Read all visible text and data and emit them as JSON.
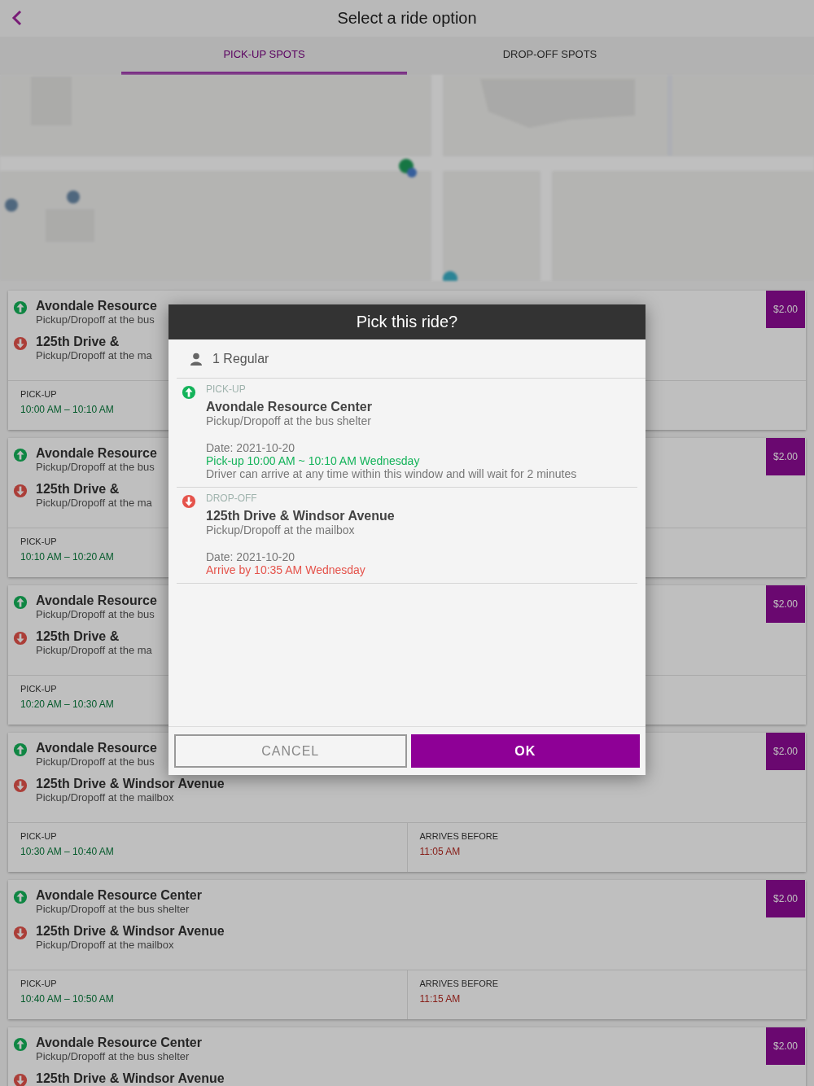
{
  "header": {
    "title": "Select a ride option"
  },
  "tabs": [
    {
      "label": "PICK-UP SPOTS",
      "selected": true
    },
    {
      "label": "DROP-OFF SPOTS",
      "selected": false
    }
  ],
  "rides": [
    {
      "pickup_name": "Avondale Resource",
      "pickup_note": "Pickup/Dropoff at the bus",
      "dropoff_name": "125th Drive &",
      "dropoff_note": "Pickup/Dropoff at the ma",
      "pickup_label": "PICK-UP",
      "pickup_window": "10:00 AM – 10:10 AM",
      "price": "$2.00"
    },
    {
      "pickup_name": "Avondale Resource",
      "pickup_note": "Pickup/Dropoff at the bus",
      "dropoff_name": "125th Drive &",
      "dropoff_note": "Pickup/Dropoff at the ma",
      "pickup_label": "PICK-UP",
      "pickup_window": "10:10 AM – 10:20 AM",
      "price": "$2.00"
    },
    {
      "pickup_name": "Avondale Resource",
      "pickup_note": "Pickup/Dropoff at the bus",
      "dropoff_name": "125th Drive &",
      "dropoff_note": "Pickup/Dropoff at the ma",
      "pickup_label": "PICK-UP",
      "pickup_window": "10:20 AM – 10:30 AM",
      "price": "$2.00"
    },
    {
      "pickup_name": "Avondale Resource",
      "pickup_note": "Pickup/Dropoff at the bus",
      "dropoff_name": "125th Drive & Windsor Avenue",
      "dropoff_note": "Pickup/Dropoff at the mailbox",
      "pickup_label": "PICK-UP",
      "pickup_window": "10:30 AM – 10:40 AM",
      "arrives_label": "ARRIVES BEFORE",
      "arrives_time": "11:05 AM",
      "price": "$2.00"
    },
    {
      "pickup_name": "Avondale Resource Center",
      "pickup_note": "Pickup/Dropoff at the bus shelter",
      "dropoff_name": "125th Drive & Windsor Avenue",
      "dropoff_note": "Pickup/Dropoff at the mailbox",
      "pickup_label": "PICK-UP",
      "pickup_window": "10:40 AM – 10:50 AM",
      "arrives_label": "ARRIVES BEFORE",
      "arrives_time": "11:15 AM",
      "price": "$2.00"
    },
    {
      "pickup_name": "Avondale Resource Center",
      "pickup_note": "Pickup/Dropoff at the bus shelter",
      "dropoff_name": "125th Drive & Windsor Avenue",
      "price": "$2.00"
    }
  ],
  "dialog": {
    "title": "Pick this ride?",
    "passengers": "1 Regular",
    "stops": [
      {
        "kind": "pickup",
        "label": "PICK-UP",
        "name": "Avondale Resource Center",
        "note": "Pickup/Dropoff at the bus shelter",
        "date": "Date: 2021-10-20",
        "time": "Pick-up 10:00 AM ~ 10:10 AM Wednesday",
        "detail": "Driver can arrive at any time within this window and will wait for 2 minutes"
      },
      {
        "kind": "dropoff",
        "label": "DROP-OFF",
        "name": "125th Drive & Windsor Avenue",
        "note": "Pickup/Dropoff at the mailbox",
        "date": "Date: 2021-10-20",
        "time": "Arrive by 10:35 AM Wednesday"
      }
    ],
    "buttons": [
      {
        "label": "CANCEL",
        "kind": "secondary"
      },
      {
        "label": "OK",
        "kind": "primary"
      }
    ]
  }
}
